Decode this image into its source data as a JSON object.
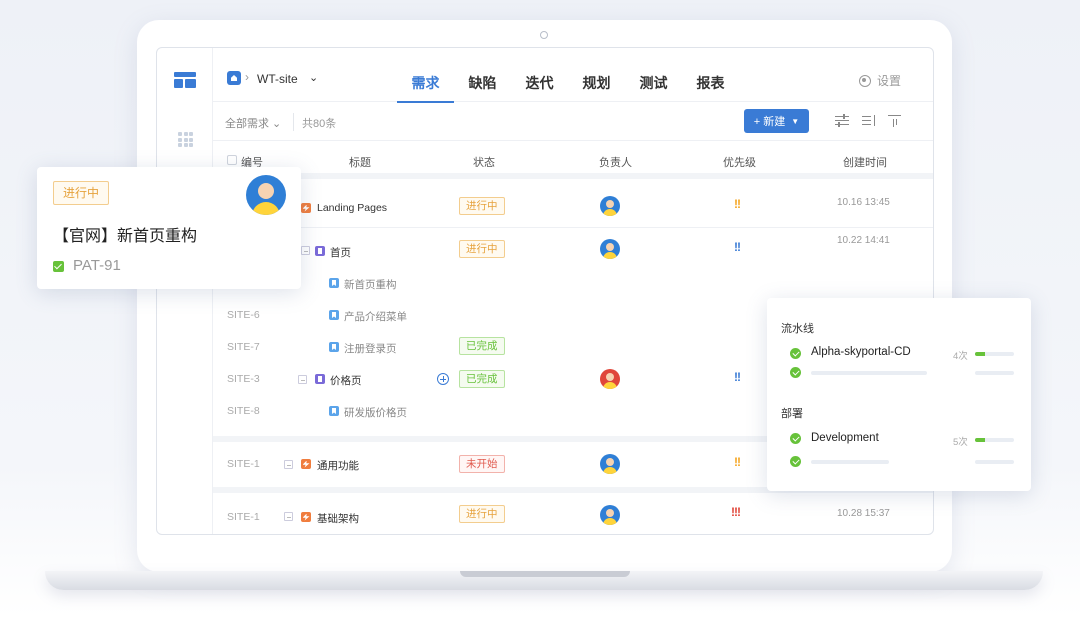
{
  "header": {
    "project": "WT-site",
    "tabs": [
      "需求",
      "缺陷",
      "迭代",
      "规划",
      "测试",
      "报表"
    ],
    "active_tab": 0,
    "settings_label": "设置"
  },
  "toolbar": {
    "filter_label": "全部需求",
    "count_label": "共80条",
    "new_button_label": "+ 新建"
  },
  "table": {
    "columns": [
      "编号",
      "标题",
      "状态",
      "负责人",
      "优先级",
      "创建时间"
    ],
    "rows": [
      {
        "code": "",
        "title": "Landing Pages",
        "type": "feature",
        "status": "进行中",
        "status_kind": "doing",
        "assignee": true,
        "priority": "!!",
        "priority_kind": "orange",
        "time": "10.16 13:45"
      },
      {
        "code": "",
        "title": "首页",
        "type": "epic",
        "status": "进行中",
        "status_kind": "doing",
        "assignee": true,
        "priority": "!!",
        "priority_kind": "blue",
        "time": "10.22 14:41"
      },
      {
        "code": "",
        "title": "新首页重构",
        "type": "story",
        "status": "",
        "assignee": false,
        "priority": "",
        "time": ""
      },
      {
        "code": "SITE-6",
        "title": "产品介绍菜单",
        "type": "story",
        "status": "",
        "assignee": false,
        "priority": "",
        "time": ""
      },
      {
        "code": "SITE-7",
        "title": "注册登录页",
        "type": "story",
        "status": "已完成",
        "status_kind": "done",
        "assignee": false,
        "priority": "",
        "time": ""
      },
      {
        "code": "SITE-3",
        "title": "价格页",
        "type": "epic",
        "status": "已完成",
        "status_kind": "done",
        "assignee": true,
        "priority": "!!",
        "priority_kind": "blue",
        "time": ""
      },
      {
        "code": "SITE-8",
        "title": "研发版价格页",
        "type": "story",
        "status": "",
        "assignee": false,
        "priority": "",
        "time": ""
      },
      {
        "code": "SITE-1",
        "title": "通用功能",
        "type": "feature",
        "status": "未开始",
        "status_kind": "todo",
        "assignee": true,
        "priority": "!!",
        "priority_kind": "orange",
        "time": ""
      },
      {
        "code": "SITE-1",
        "title": "基础架构",
        "type": "feature",
        "status": "进行中",
        "status_kind": "doing",
        "assignee": true,
        "priority": "!!!",
        "priority_kind": "red",
        "time": "10.28 15:37"
      }
    ]
  },
  "card_left": {
    "status": "进行中",
    "title": "【官网】新首页重构",
    "id": "PAT-91"
  },
  "card_right": {
    "pipeline_title": "流水线",
    "pipeline_name": "Alpha-skyportal-CD",
    "pipeline_times": "4次",
    "pipeline_progress": 0.25,
    "deploy_title": "部署",
    "deploy_name": "Development",
    "deploy_times": "5次",
    "deploy_progress": 0.25
  },
  "colors": {
    "accent": "#3a7bd5",
    "doing": "#e6a23c",
    "done": "#67c23a",
    "todo": "#e05a4e"
  }
}
